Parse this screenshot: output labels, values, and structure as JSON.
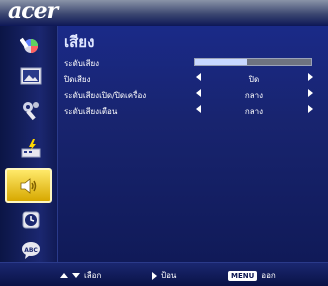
{
  "brand": {
    "logo_text": "acer"
  },
  "sidebar": {
    "items": [
      {
        "icon": "color-wheel-icon",
        "active": false
      },
      {
        "icon": "image-icon",
        "active": false
      },
      {
        "icon": "settings-wrench-icon",
        "active": false
      },
      {
        "icon": "management-icon",
        "active": false
      },
      {
        "icon": "speaker-icon",
        "active": true
      },
      {
        "icon": "timer-clock-icon",
        "active": false
      },
      {
        "icon": "language-abc-icon",
        "active": false
      }
    ]
  },
  "panel": {
    "title": "เสียง",
    "rows": [
      {
        "label": "ระดับเสียง",
        "type": "slider",
        "level_percent": 45
      },
      {
        "label": "ปิดเสียง",
        "type": "option",
        "value": "ปิด"
      },
      {
        "label": "ระดับเสียงเปิด/ปิดเครื่อง",
        "type": "option",
        "value": "กลาง"
      },
      {
        "label": "ระดับเสียงเตือน",
        "type": "option",
        "value": "กลาง"
      }
    ]
  },
  "footer": {
    "select_label": "เลือก",
    "enter_label": "ป้อน",
    "menu_key": "MENU",
    "exit_label": "ออก"
  },
  "colors": {
    "background": "#0a1450",
    "active_highlight": "#ffd800"
  }
}
